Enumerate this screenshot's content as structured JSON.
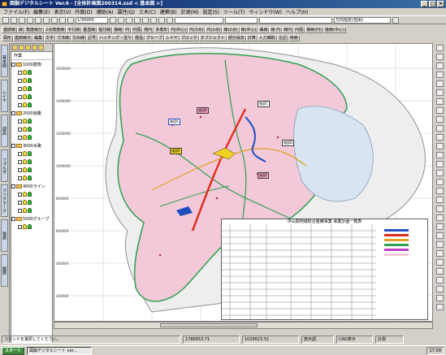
{
  "window": {
    "title": "図脳デジタルシート Ver.6 - [全体計画図200314.zsd < 基本図 >]",
    "controls": [
      "_",
      "□",
      "×"
    ]
  },
  "menubar": {
    "items": [
      "ファイル(F)",
      "編集(E)",
      "表示(V)",
      "作図(D)",
      "補助(A)",
      "属性(Q)",
      "土木(C)",
      "建築(B)",
      "計測(M)",
      "設定(S)",
      "ツール(T)",
      "ウィンドウ(W)",
      "ヘルプ(H)"
    ]
  },
  "toolbar": {
    "scale": "1/30000",
    "direction_combo": "方向指定(自由)"
  },
  "command_row_1": [
    "連続線",
    "線",
    "角度線分",
    "2点角度線",
    "平行線",
    "垂直線",
    "幅付線",
    "接線",
    "円",
    "円弧",
    "楕円",
    "多角形",
    "円(中心)",
    "円(3点)",
    "円(2点)",
    "線(2点)",
    "線(中心)",
    "曲線",
    "線 円",
    "線円",
    "円弧",
    "接線(円)",
    "接線(中心)"
  ],
  "command_row_2": [
    "図形",
    "連続線分",
    "編集",
    "文字",
    "寸法線",
    "引出線",
    "記号",
    "ハッチング・塗り",
    "部品",
    "グループ",
    "レイヤ",
    "ブロック",
    "オブジェクト",
    "部分消去",
    "計算",
    "入力補助",
    "注記",
    "検索"
  ],
  "layers": {
    "tab": "作業",
    "items": [
      {
        "label": "1000建物"
      },
      {
        "label": "2000道路"
      },
      {
        "label": "3000水路"
      },
      {
        "label": "4000ライン"
      },
      {
        "label": "5000グループ"
      }
    ]
  },
  "left_vertical_tabs": [
    "基本図",
    "レイヤ",
    "部品",
    "フォルダ",
    "ブックマーク",
    "検索",
    "履歴"
  ],
  "map": {
    "labels": [
      "施設A",
      "施設B",
      "施設C",
      "施設D",
      "施設E",
      "施設F"
    ],
    "axis_labels": [
      "1600000",
      "1400000",
      "1200000",
      "1000000",
      "800000",
      "600000",
      "400000",
      "200000"
    ]
  },
  "summary_table": {
    "title": "中山間地域総合整備事業 事業計画一覧表"
  },
  "statusbar": {
    "message": "コマンドを選択してください。",
    "x": "1766653.71",
    "y": "1029623.51",
    "mode1": "表示調",
    "mode2": "CAD表示",
    "mode3": "計測"
  },
  "taskbar": {
    "start": "スタート",
    "task": "図脳デジタルシート ver...",
    "clock": "17:09"
  },
  "colors": {
    "titlebar": "#0a246a",
    "map_boundary": "#30a050",
    "map_fill": "#f3c8d8",
    "road": "#e03020",
    "water": "#2050c0"
  }
}
